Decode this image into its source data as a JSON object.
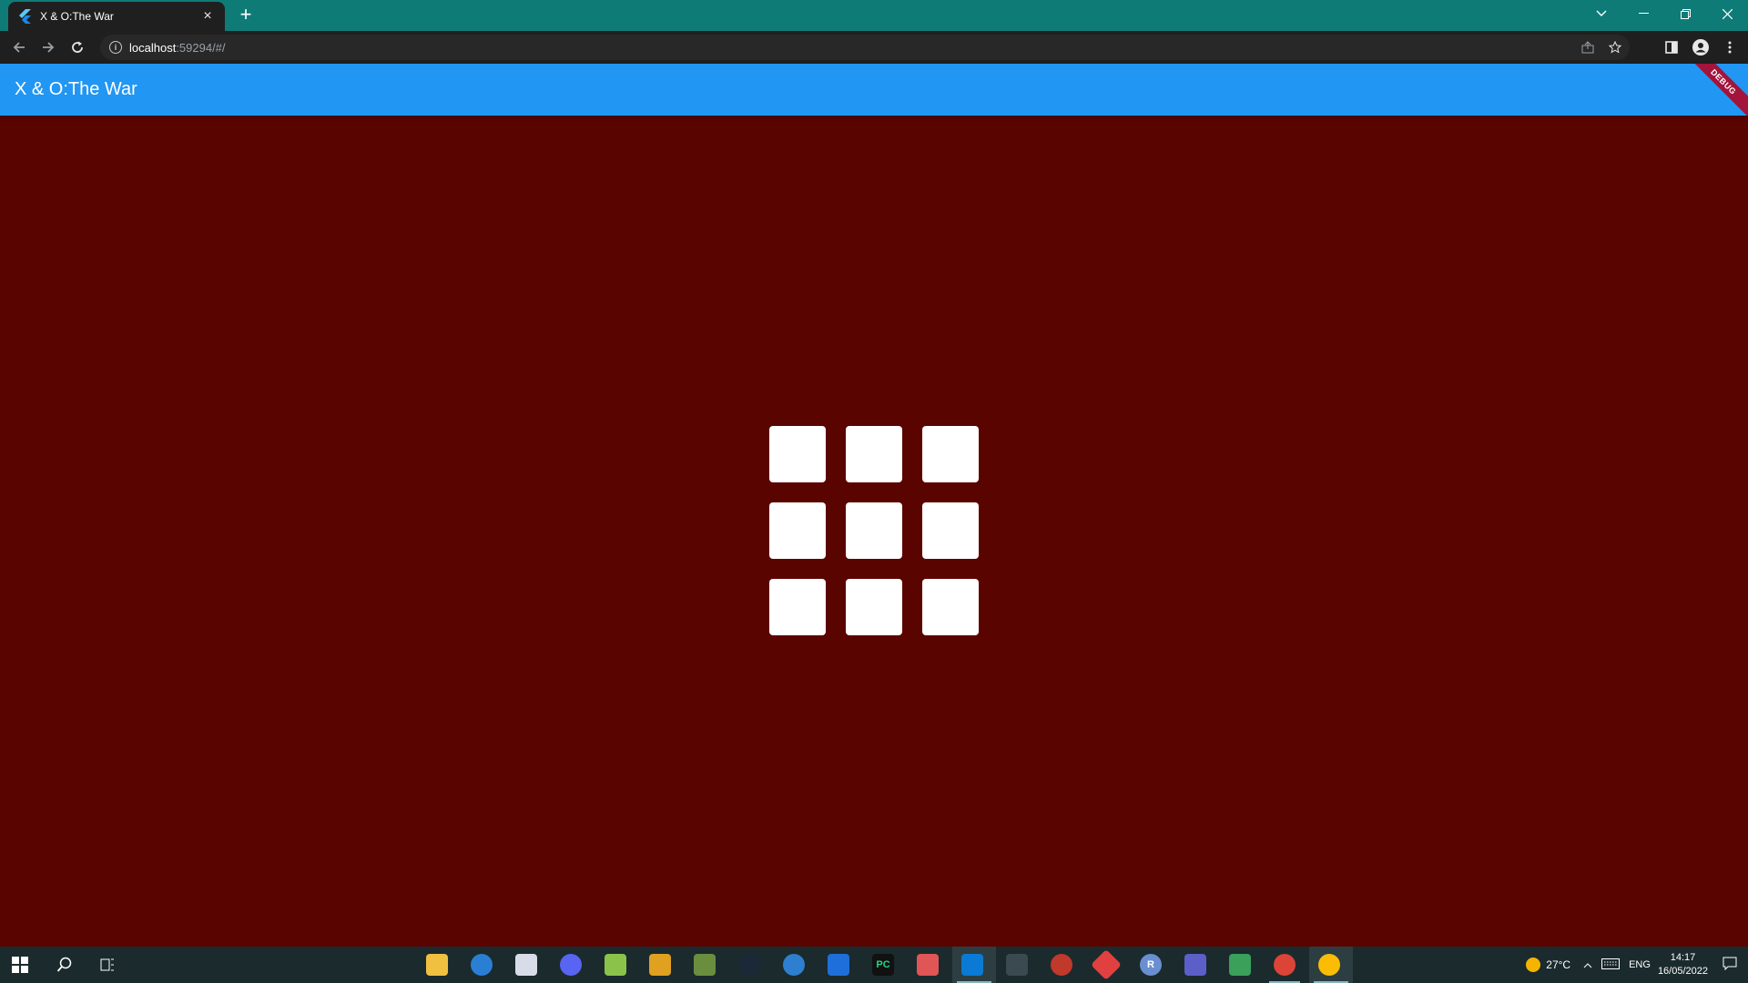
{
  "browser": {
    "tab_title": "X & O:The War",
    "tab_close": "×",
    "new_tab": "+",
    "url_host": "localhost",
    "url_rest": ":59294/#/"
  },
  "app": {
    "title": "X & O:The War",
    "debug_banner": "DEBUG",
    "board": {
      "cells": [
        "",
        "",
        "",
        "",
        "",
        "",
        "",
        "",
        ""
      ]
    }
  },
  "taskbar": {
    "weather": "27°C",
    "language": "ENG",
    "time": "14:17",
    "date": "16/05/2022"
  },
  "colors": {
    "background": "#5a0400",
    "appbar": "#2196f3",
    "tabbar": "#0f7b77",
    "cell": "#ffffff"
  }
}
